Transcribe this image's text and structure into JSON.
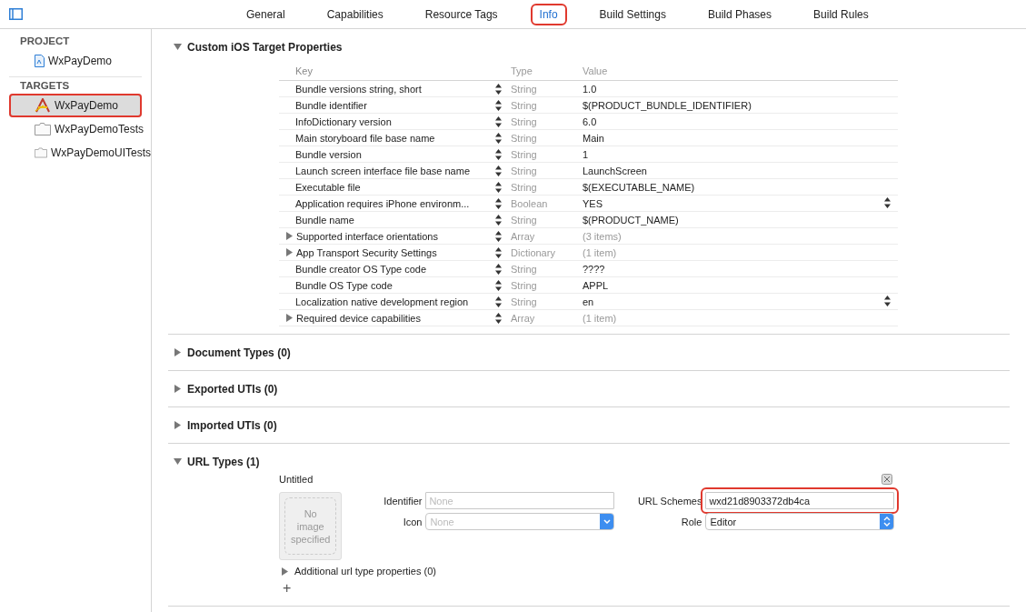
{
  "toolbar": {
    "tabs": [
      {
        "label": "General",
        "selected": false,
        "highlighted": false
      },
      {
        "label": "Capabilities",
        "selected": false,
        "highlighted": false
      },
      {
        "label": "Resource Tags",
        "selected": false,
        "highlighted": false
      },
      {
        "label": "Info",
        "selected": true,
        "highlighted": true
      },
      {
        "label": "Build Settings",
        "selected": false,
        "highlighted": false
      },
      {
        "label": "Build Phases",
        "selected": false,
        "highlighted": false
      },
      {
        "label": "Build Rules",
        "selected": false,
        "highlighted": false
      }
    ]
  },
  "sidebar": {
    "groups": [
      {
        "title": "PROJECT",
        "items": [
          {
            "label": "WxPayDemo",
            "kind": "project",
            "selected": false,
            "highlighted": false
          }
        ]
      },
      {
        "title": "TARGETS",
        "items": [
          {
            "label": "WxPayDemo",
            "kind": "app",
            "selected": true,
            "highlighted": true
          },
          {
            "label": "WxPayDemoTests",
            "kind": "bundle",
            "selected": false,
            "highlighted": false
          },
          {
            "label": "WxPayDemoUITests",
            "kind": "bundle",
            "selected": false,
            "highlighted": false
          }
        ]
      }
    ]
  },
  "sections": [
    {
      "title": "Custom iOS Target Properties",
      "expanded": true,
      "kind": "properties",
      "table": {
        "columns": [
          "Key",
          "Type",
          "Value"
        ],
        "rows": [
          {
            "key": "Bundle versions string, short",
            "type": "String",
            "value": "1.0",
            "expandable": false,
            "popup": false
          },
          {
            "key": "Bundle identifier",
            "type": "String",
            "value": "$(PRODUCT_BUNDLE_IDENTIFIER)",
            "expandable": false,
            "popup": false
          },
          {
            "key": "InfoDictionary version",
            "type": "String",
            "value": "6.0",
            "expandable": false,
            "popup": false
          },
          {
            "key": "Main storyboard file base name",
            "type": "String",
            "value": "Main",
            "expandable": false,
            "popup": false
          },
          {
            "key": "Bundle version",
            "type": "String",
            "value": "1",
            "expandable": false,
            "popup": false
          },
          {
            "key": "Launch screen interface file base name",
            "type": "String",
            "value": "LaunchScreen",
            "expandable": false,
            "popup": false
          },
          {
            "key": "Executable file",
            "type": "String",
            "value": "$(EXECUTABLE_NAME)",
            "expandable": false,
            "popup": false
          },
          {
            "key": "Application requires iPhone environm...",
            "type": "Boolean",
            "value": "YES",
            "expandable": false,
            "popup": true
          },
          {
            "key": "Bundle name",
            "type": "String",
            "value": "$(PRODUCT_NAME)",
            "expandable": false,
            "popup": false
          },
          {
            "key": "Supported interface orientations",
            "type": "Array",
            "value": "(3 items)",
            "expandable": true,
            "popup": false
          },
          {
            "key": "App Transport Security Settings",
            "type": "Dictionary",
            "value": "(1 item)",
            "expandable": true,
            "popup": false
          },
          {
            "key": "Bundle creator OS Type code",
            "type": "String",
            "value": "????",
            "expandable": false,
            "popup": false
          },
          {
            "key": "Bundle OS Type code",
            "type": "String",
            "value": "APPL",
            "expandable": false,
            "popup": false
          },
          {
            "key": "Localization native development region",
            "type": "String",
            "value": "en",
            "expandable": false,
            "popup": true
          },
          {
            "key": "Required device capabilities",
            "type": "Array",
            "value": "(1 item)",
            "expandable": true,
            "popup": false
          }
        ]
      }
    },
    {
      "title": "Document Types (0)",
      "expanded": false,
      "kind": "plain"
    },
    {
      "title": "Exported UTIs (0)",
      "expanded": false,
      "kind": "plain"
    },
    {
      "title": "Imported UTIs (0)",
      "expanded": false,
      "kind": "plain"
    },
    {
      "title": "URL Types (1)",
      "expanded": true,
      "kind": "url_types",
      "url_type": {
        "name": "Untitled",
        "image_text": "No image specified",
        "identifier_label": "Identifier",
        "identifier_placeholder": "None",
        "icon_label": "Icon",
        "icon_placeholder": "None",
        "schemes_label": "URL Schemes",
        "schemes_value": "wxd21d8903372db4ca",
        "schemes_highlighted": true,
        "role_label": "Role",
        "role_value": "Editor",
        "additional": "Additional url type properties (0)",
        "add": "+"
      }
    }
  ]
}
